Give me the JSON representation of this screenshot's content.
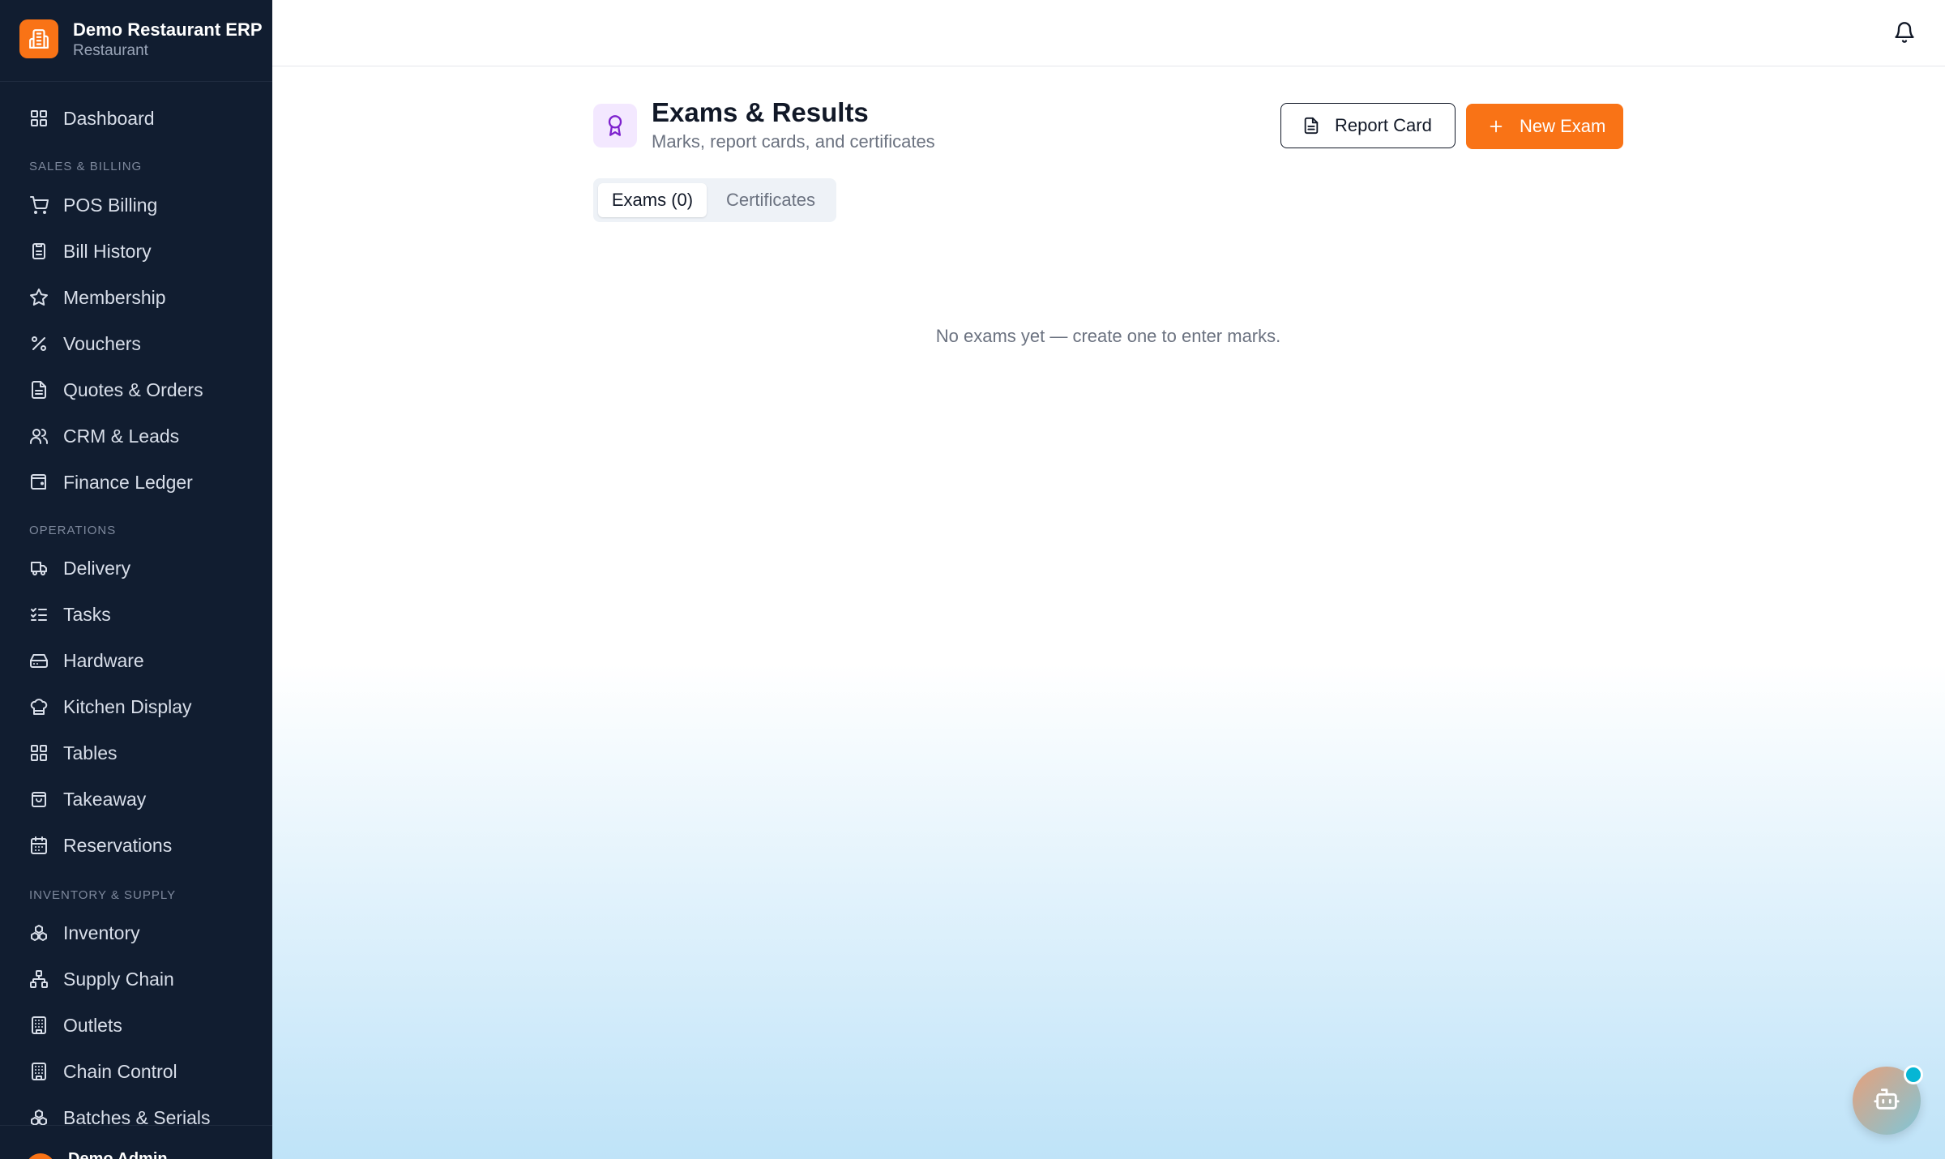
{
  "brand": {
    "name": "Demo Restaurant ERP",
    "subtitle": "Restaurant"
  },
  "sidebar": {
    "sections": [
      "SALES & BILLING",
      "OPERATIONS",
      "INVENTORY & SUPPLY"
    ],
    "items": [
      {
        "label": "Dashboard",
        "icon": "grid-icon"
      },
      {
        "label": "POS Billing",
        "icon": "cart-icon"
      },
      {
        "label": "Bill History",
        "icon": "clipboard-icon"
      },
      {
        "label": "Membership",
        "icon": "star-icon"
      },
      {
        "label": "Vouchers",
        "icon": "percent-icon"
      },
      {
        "label": "Quotes & Orders",
        "icon": "document-icon"
      },
      {
        "label": "CRM & Leads",
        "icon": "users-icon"
      },
      {
        "label": "Finance Ledger",
        "icon": "wallet-icon"
      },
      {
        "label": "Delivery",
        "icon": "truck-icon"
      },
      {
        "label": "Tasks",
        "icon": "checklist-icon"
      },
      {
        "label": "Hardware",
        "icon": "drive-icon"
      },
      {
        "label": "Kitchen Display",
        "icon": "chef-hat-icon"
      },
      {
        "label": "Tables",
        "icon": "grid-icon"
      },
      {
        "label": "Takeaway",
        "icon": "bag-icon"
      },
      {
        "label": "Reservations",
        "icon": "calendar-icon"
      },
      {
        "label": "Inventory",
        "icon": "boxes-icon"
      },
      {
        "label": "Supply Chain",
        "icon": "network-icon"
      },
      {
        "label": "Outlets",
        "icon": "building-icon"
      },
      {
        "label": "Chain Control",
        "icon": "building-icon"
      },
      {
        "label": "Batches & Serials",
        "icon": "boxes-icon"
      }
    ],
    "footer_user": "Demo Admin"
  },
  "page": {
    "title": "Exams & Results",
    "subtitle": "Marks, report cards, and certificates",
    "report_card_label": "Report Card",
    "new_exam_label": "New Exam",
    "tabs": [
      {
        "label": "Exams (0)",
        "active": true
      },
      {
        "label": "Certificates",
        "active": false
      }
    ],
    "empty_message": "No exams yet — create one to enter marks."
  },
  "colors": {
    "accent": "#f97316",
    "sidebar_bg": "#111d30",
    "badge_bg": "#f3e8ff",
    "badge_icon": "#7e22ce",
    "assistant_dot": "#06b6d4"
  }
}
